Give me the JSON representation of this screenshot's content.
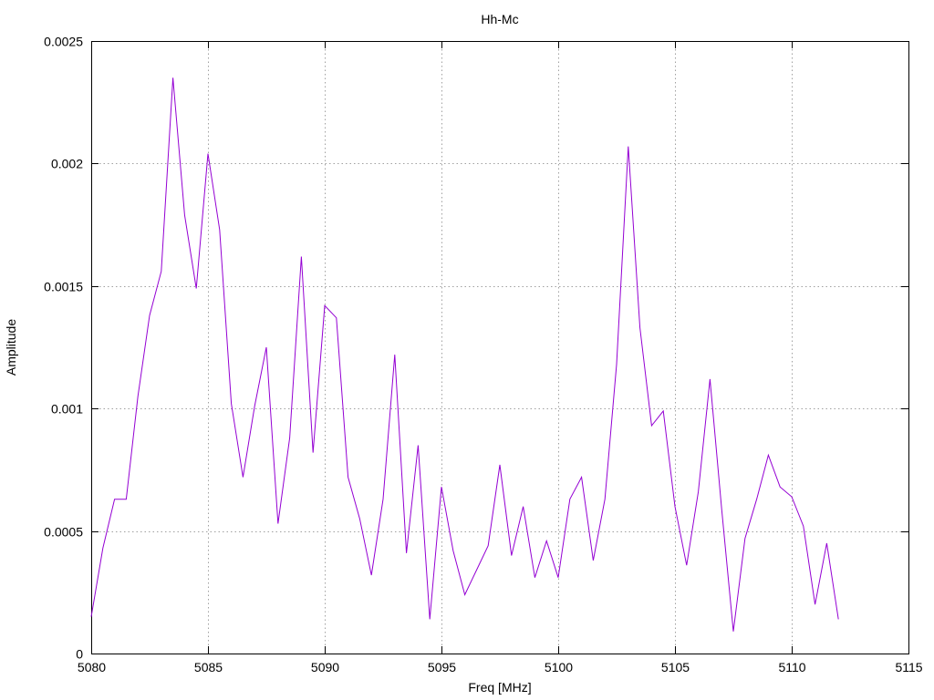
{
  "chart_data": {
    "type": "line",
    "title": "Hh-Mc",
    "xlabel": "Freq [MHz]",
    "ylabel": "Amplitude",
    "xlim": [
      5080,
      5115
    ],
    "ylim": [
      0,
      0.0025
    ],
    "x_ticks": [
      5080,
      5085,
      5090,
      5095,
      5100,
      5105,
      5110,
      5115
    ],
    "x_tick_labels": [
      "5080",
      "5085",
      "5090",
      "5095",
      "5100",
      "5105",
      "5110",
      "5115"
    ],
    "y_ticks": [
      0,
      0.0005,
      0.001,
      0.0015,
      0.002,
      0.0025
    ],
    "y_tick_labels": [
      "0",
      "0.0005",
      "0.001",
      "0.0015",
      "0.002",
      "0.0025"
    ],
    "grid": true,
    "series": [
      {
        "color": "#9400d3",
        "x": [
          5080.0,
          5080.5,
          5081.0,
          5081.5,
          5082.0,
          5082.5,
          5083.0,
          5083.5,
          5084.0,
          5084.5,
          5085.0,
          5085.5,
          5086.0,
          5086.5,
          5087.0,
          5087.5,
          5088.0,
          5088.5,
          5089.0,
          5089.5,
          5090.0,
          5090.5,
          5091.0,
          5091.5,
          5092.0,
          5092.5,
          5093.0,
          5093.5,
          5094.0,
          5094.5,
          5095.0,
          5095.5,
          5096.0,
          5096.5,
          5097.0,
          5097.5,
          5098.0,
          5098.5,
          5099.0,
          5099.5,
          5100.0,
          5100.5,
          5101.0,
          5101.5,
          5102.0,
          5102.5,
          5103.0,
          5103.5,
          5104.0,
          5104.5,
          5105.0,
          5105.5,
          5106.0,
          5106.5,
          5107.0,
          5107.5,
          5108.0,
          5108.5,
          5109.0,
          5109.5,
          5110.0,
          5110.5,
          5111.0,
          5111.5,
          5112.0
        ],
        "y": [
          0.00015,
          0.00043,
          0.00063,
          0.00063,
          0.00105,
          0.00138,
          0.00156,
          0.00235,
          0.00179,
          0.00149,
          0.00204,
          0.00173,
          0.00102,
          0.00072,
          0.00101,
          0.00125,
          0.00053,
          0.00088,
          0.00162,
          0.00082,
          0.00142,
          0.00137,
          0.00072,
          0.00055,
          0.00032,
          0.00063,
          0.00122,
          0.00041,
          0.00085,
          0.00014,
          0.00068,
          0.00042,
          0.00024,
          0.00034,
          0.00044,
          0.00077,
          0.0004,
          0.0006,
          0.00031,
          0.00046,
          0.00031,
          0.00063,
          0.00072,
          0.00038,
          0.00063,
          0.00118,
          0.00207,
          0.00133,
          0.00093,
          0.00099,
          0.0006,
          0.00036,
          0.00066,
          0.00112,
          0.00059,
          9e-05,
          0.00047,
          0.00063,
          0.00081,
          0.00068,
          0.00064,
          0.00052,
          0.0002,
          0.00045,
          0.00014
        ]
      }
    ]
  }
}
